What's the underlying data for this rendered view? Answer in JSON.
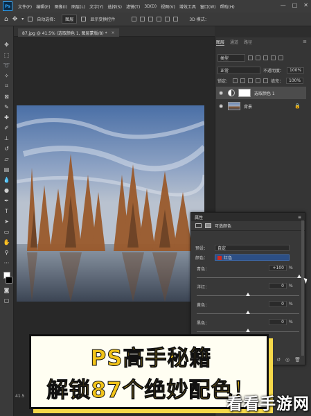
{
  "app": {
    "logo": "Ps",
    "menu": [
      "文件(F)",
      "编辑(E)",
      "图像(I)",
      "图层(L)",
      "文字(Y)",
      "选择(S)",
      "滤镜(T)",
      "3D(D)",
      "视图(V)",
      "增效工具",
      "窗口(W)",
      "帮助(H)"
    ],
    "window_controls": [
      "—",
      "□",
      "✕"
    ]
  },
  "options_bar": {
    "auto_select_label": "自动选择：",
    "auto_select_value": "图层",
    "show_transform_label": "显示变换控件",
    "mode_3d": "3D 模式："
  },
  "document": {
    "tab_label": "87.jpg @ 41.5% (选取颜色 1, 图层蒙版/8) *",
    "close": "×",
    "status_zoom": "41.5"
  },
  "layers_panel": {
    "tabs": [
      "图层",
      "通道",
      "路径"
    ],
    "filter_kind": "类型",
    "blend_mode": "正常",
    "opacity_label": "不透明度：",
    "opacity_value": "100%",
    "lock_label": "锁定：",
    "fill_label": "填充：",
    "fill_value": "100%",
    "layers": [
      {
        "name": "选取颜色 1",
        "selected": true,
        "visible": true
      },
      {
        "name": "背景",
        "selected": false,
        "visible": true,
        "locked": true
      }
    ]
  },
  "properties_panel": {
    "title": "属性",
    "subtitle": "可选颜色",
    "preset_label": "预设：",
    "preset_value": "自定",
    "colors_label": "颜色：",
    "colors_value": "红色",
    "sliders": [
      {
        "label": "青色：",
        "value": "+100",
        "unit": "%",
        "level": 1.0
      },
      {
        "label": "洋红：",
        "value": "0",
        "unit": "%",
        "level": 0.5
      },
      {
        "label": "黄色：",
        "value": "0",
        "unit": "%",
        "level": 0.5
      },
      {
        "label": "黑色：",
        "value": "0",
        "unit": "%",
        "level": 0.5
      }
    ]
  },
  "banner": {
    "line1": "PS高手秘籍",
    "line2": "解锁87个绝妙配色！"
  },
  "watermark": "看看手游网",
  "colors": {
    "accent_red": "#d02a1e",
    "banner_yellow": "#f2c418",
    "ps_blue": "#31a8ff"
  }
}
